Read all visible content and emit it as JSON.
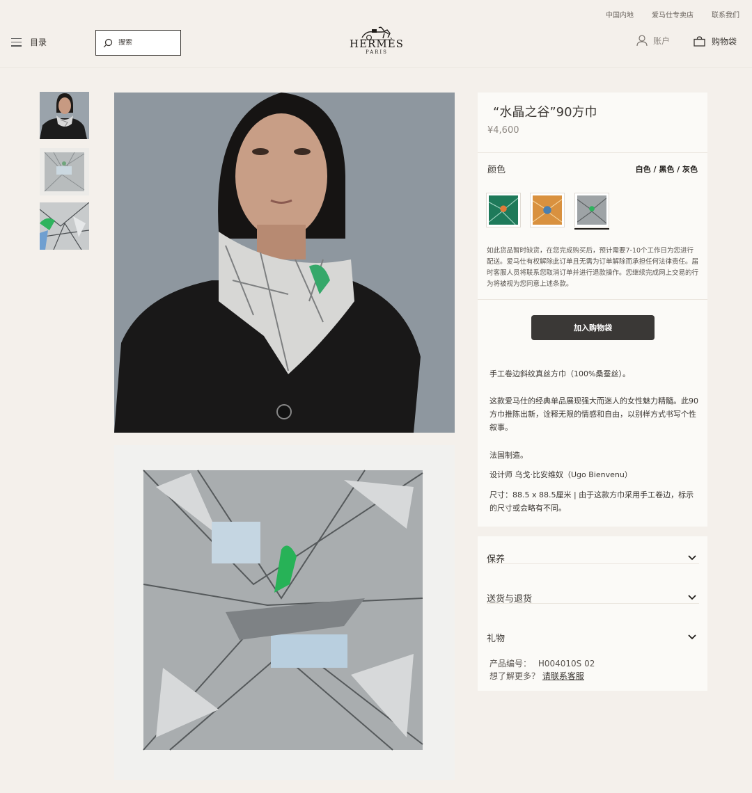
{
  "header": {
    "utility_links": [
      "中国内地",
      "爱马仕专卖店",
      "联系我们"
    ],
    "menu_label": "目录",
    "search_placeholder": "搜索",
    "logo_brand": "HERMÈS",
    "logo_city": "PARIS",
    "account_label": "账户",
    "bag_label": "购物袋"
  },
  "product": {
    "title": "“水晶之谷”90方巾",
    "price": "¥4,600",
    "color_label": "颜色",
    "color_value": "白色 / 黑色 / 灰色",
    "swatches": [
      {
        "name": "green-swatch",
        "selected": false
      },
      {
        "name": "orange-swatch",
        "selected": false
      },
      {
        "name": "grey-swatch",
        "selected": true
      }
    ],
    "notice": "如此货品暂时缺货，在您完成购买后，预计需要7-10个工作日为您进行配送。爱马仕有权解除此订单且无需为订单解除而承担任何法律责任。届时客服人员将联系您取消订单并进行退款操作。您继续完成网上交易的行为将被视为您同意上述条款。",
    "add_to_bag": "加入购物袋",
    "description": [
      "手工卷边斜纹真丝方巾（100%桑蚕丝）。",
      "这款爱马仕的经典单品展现强大而迷人的女性魅力精髓。此90方巾推陈出新，诠释无限的情感和自由，以别样方式书写个性叙事。",
      "法国制造。",
      "设计师 乌戈·比安维奴（Ugo Bienvenu）",
      "尺寸：88.5 x 88.5厘米 | 由于这款方巾采用手工卷边，标示的尺寸或会略有不同。"
    ]
  },
  "accordion": [
    "保养",
    "送货与退货",
    "礼物"
  ],
  "product_info": {
    "code_label": "产品编号：",
    "code_value": "H004010S 02",
    "more_label": "想了解更多？",
    "more_link": "请联系客服"
  },
  "colors": {
    "background": "#f4f0eb",
    "panel": "#fbfaf7",
    "button": "#3a3836",
    "text": "#3a3632"
  }
}
